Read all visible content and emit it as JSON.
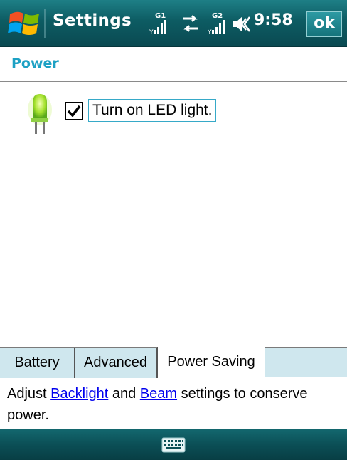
{
  "titlebar": {
    "title": "Settings",
    "clock": "9:58",
    "ok_label": "ok",
    "status_icons": [
      "signal-g1-icon",
      "data-transfer-icon",
      "signal-g2-icon",
      "volume-icon"
    ],
    "signal1_label": "G1",
    "signal2_label": "G2"
  },
  "page": {
    "title": "Power"
  },
  "content": {
    "led_checkbox": {
      "label": "Turn on LED light.",
      "checked": true
    }
  },
  "tabs": [
    {
      "label": "Battery"
    },
    {
      "label": "Advanced"
    },
    {
      "label": "Power Saving",
      "active": true
    }
  ],
  "description": {
    "prefix": "Adjust ",
    "link1": "Backlight",
    "middle": " and ",
    "link2": "Beam",
    "suffix": " settings to conserve power."
  },
  "bottombar": {
    "icon": "keyboard-icon"
  },
  "colors": {
    "accent": "#1da1c4",
    "titlebar": "#0d5c63",
    "tab_bg": "#cfe7ee",
    "link": "#0000ee"
  }
}
